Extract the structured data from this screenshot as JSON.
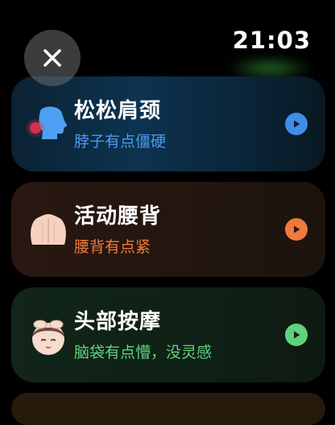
{
  "status": {
    "time": "21:03"
  },
  "header": {
    "close_icon": "close-icon"
  },
  "cards": [
    {
      "title": "松松肩颈",
      "subtitle": "脖子有点僵硬",
      "icon": "neck-icon",
      "accent": "#4c9af0"
    },
    {
      "title": "活动腰背",
      "subtitle": "腰背有点紧",
      "icon": "back-icon",
      "accent": "#f07a3f"
    },
    {
      "title": "头部按摩",
      "subtitle": "脑袋有点懵，没灵感",
      "icon": "head-massage-icon",
      "accent": "#5fd27d"
    }
  ]
}
